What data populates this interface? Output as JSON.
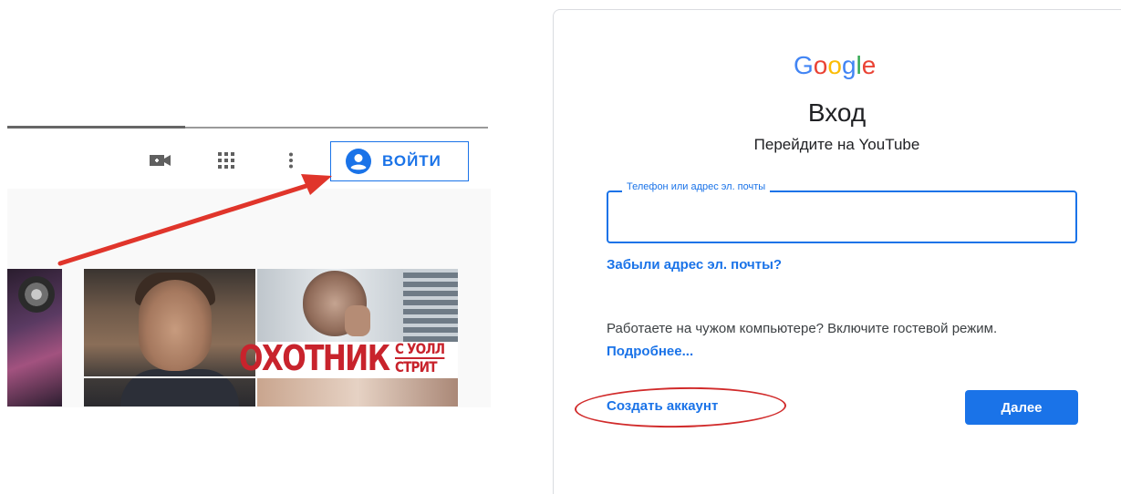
{
  "youtube": {
    "signin_label": "ВОЙТИ",
    "poster": {
      "title_big": "ОХОТНИК",
      "title_small_1": "С УОЛЛ",
      "title_small_2": "СТРИТ"
    }
  },
  "google_signin": {
    "logo": [
      "G",
      "o",
      "o",
      "g",
      "l",
      "e"
    ],
    "logo_colors": [
      "#4285f4",
      "#ea4335",
      "#fbbc05",
      "#4285f4",
      "#34a853",
      "#ea4335"
    ],
    "title": "Вход",
    "subtitle": "Перейдите на YouTube",
    "email_label": "Телефон или адрес эл. почты",
    "email_value": "",
    "forgot_link": "Забыли адрес эл. почты?",
    "guest_text": "Работаете на чужом компьютере? Включите гостевой режим.",
    "learn_more": "Подробнее...",
    "create_account": "Создать аккаунт",
    "next_button": "Далее"
  },
  "annotations": {
    "arrow_color": "#e0352b",
    "highlight_color": "#d12b2b"
  },
  "icons": {
    "video": "video-camera-icon",
    "apps": "apps-grid-icon",
    "more": "more-vert-icon",
    "avatar": "account-circle-icon"
  }
}
